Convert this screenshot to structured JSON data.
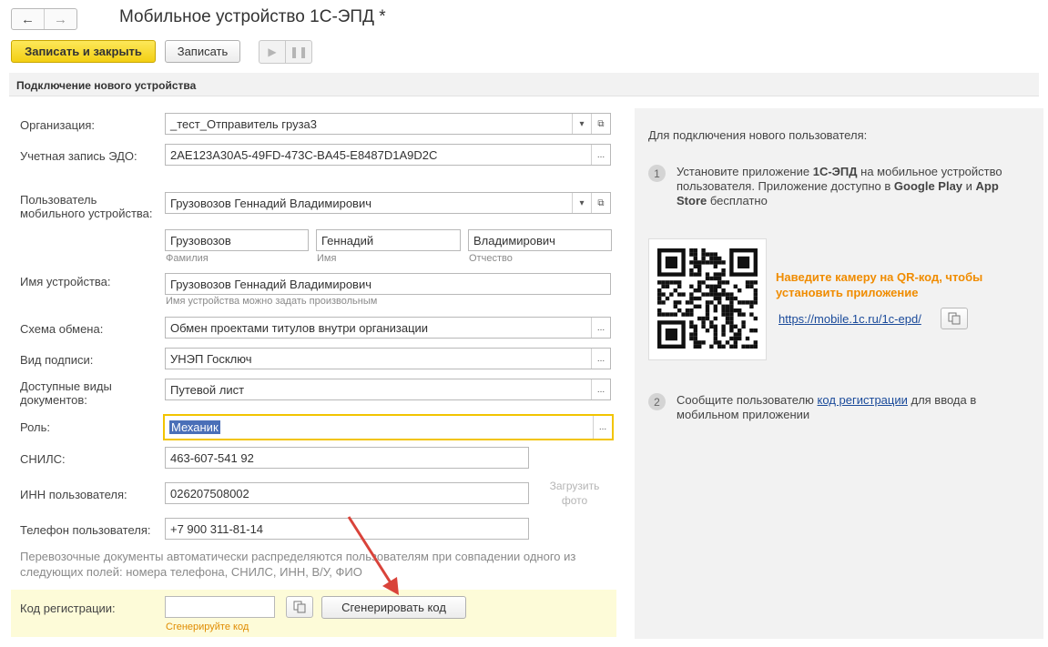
{
  "window": {
    "title": "Мобильное устройство 1С-ЭПД *",
    "back_glyph": "←",
    "forward_glyph": "→"
  },
  "toolbar": {
    "save_close_label": "Записать и закрыть",
    "save_label": "Записать",
    "play_glyph": "▶",
    "pause_glyph": "❚❚"
  },
  "section_title": "Подключение нового устройства",
  "form": {
    "org_label": "Организация:",
    "org_value": "_тест_Отправитель груза3",
    "edo_label": "Учетная запись ЭДО:",
    "edo_value": "2AE123A30A5-49FD-473C-BA45-E8487D1A9D2C",
    "user_label": "Пользователь мобильного устройства:",
    "user_value": "Грузовозов Геннадий Владимирович",
    "last_name": "Грузовозов",
    "last_name_hint": "Фамилия",
    "first_name": "Геннадий",
    "first_name_hint": "Имя",
    "patronymic": "Владимирович",
    "patronymic_hint": "Отчество",
    "device_name_label": "Имя устройства:",
    "device_name_value": "Грузовозов Геннадий Владимирович",
    "device_name_hint": "Имя устройства можно задать произвольным",
    "scheme_label": "Схема обмена:",
    "scheme_value": "Обмен проектами титулов внутри организации",
    "sign_label": "Вид подписи:",
    "sign_value": "УНЭП Госключ",
    "doc_types_label": "Доступные виды документов:",
    "doc_types_value": "Путевой лист",
    "role_label": "Роль:",
    "role_value": "Механик",
    "snils_label": "СНИЛС:",
    "snils_value": "463-607-541 92",
    "inn_label": "ИНН пользователя:",
    "inn_value": "026207508002",
    "phone_label": "Телефон пользователя:",
    "phone_value": "+7 900 311-81-14",
    "upload_photo": "Загрузить фото",
    "note": "Перевозочные документы автоматически распределяются пользователям при совпадении одного из следующих полей: номера телефона, СНИЛС, ИНН, В/У, ФИО",
    "reg_code_label": "Код регистрации:",
    "reg_code_value": "",
    "reg_code_hint": "Сгенерируйте код",
    "generate_button": "Сгенерировать код",
    "ellipsis": "...",
    "dropdown_glyph": "▾",
    "open_glyph": "⧉"
  },
  "right_panel": {
    "intro": "Для подключения нового пользователя:",
    "step1_num": "1",
    "step1_part1": "Установите приложение ",
    "step1_app": "1С-ЭПД",
    "step1_part2": " на мобильное устройство пользователя. Приложение доступно в ",
    "step1_gp": "Google Play",
    "step1_and": " и ",
    "step1_as": "App Store",
    "step1_end": " бесплатно",
    "qr_caption": "Наведите камеру на QR-код, чтобы установить приложение",
    "qr_link": "https://mobile.1c.ru/1c-epd/",
    "step2_num": "2",
    "step2_part1": "Сообщите пользователю ",
    "step2_link": "код регистрации",
    "step2_part2": " для ввода в мобильном приложении"
  },
  "colors": {
    "primary_button": "#f3cf13",
    "focus_border": "#f2c400",
    "link": "#1a4a9a",
    "orange_text": "#f08c00",
    "arrow": "#d9433a"
  }
}
